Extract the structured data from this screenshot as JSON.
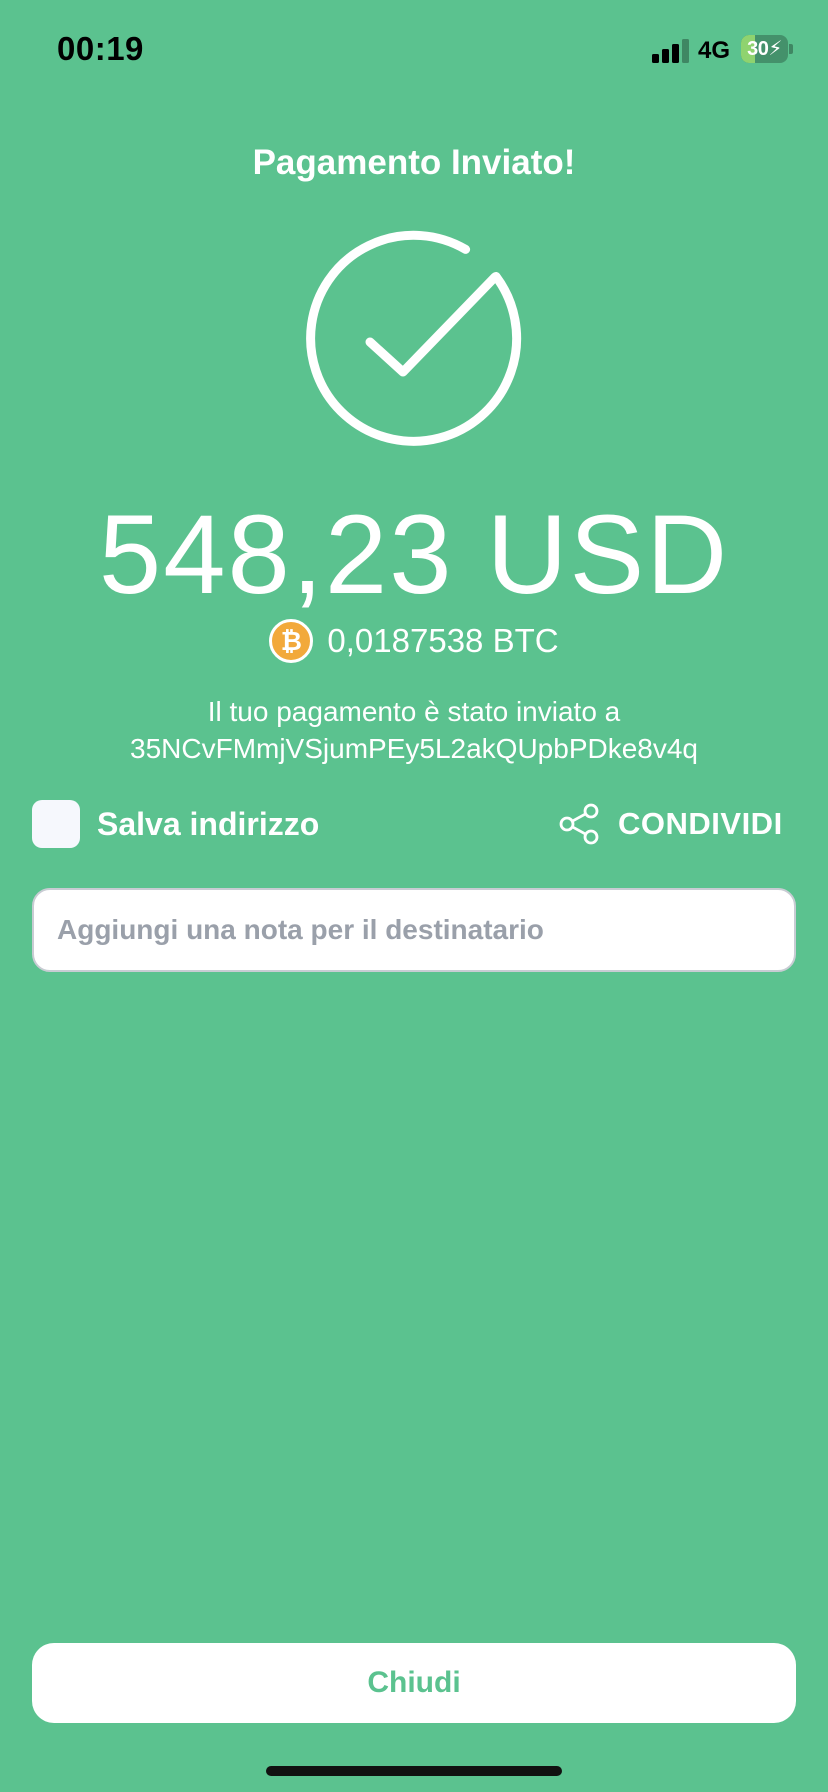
{
  "status_bar": {
    "time": "00:19",
    "network": "4G",
    "battery_level": "30",
    "battery_fraction": 0.3,
    "signal_icon": "cellular-signal-icon",
    "battery_icon": "battery-charging-icon"
  },
  "title": "Pagamento Inviato!",
  "success_icon": "checkmark-circle-icon",
  "amount": {
    "usd": "548,23 USD",
    "btc": "0,0187538 BTC",
    "btc_icon": "bitcoin-icon",
    "btc_symbol": "₿"
  },
  "message": {
    "line1": "Il tuo pagamento è stato inviato a",
    "address": "35NCvFMmjVSjumPEy5L2akQUpbPDke8v4q"
  },
  "save_address": {
    "label": "Salva indirizzo",
    "checked": false
  },
  "share": {
    "label": "CONDIVIDI",
    "icon": "share-icon"
  },
  "note": {
    "placeholder": "Aggiungi una nota per il destinatario",
    "value": ""
  },
  "close_button": {
    "label": "Chiudi"
  },
  "colors": {
    "background": "#5bc28f",
    "accent": "#5bc28f",
    "bitcoin": "#f2a93b",
    "text": "#ffffff"
  }
}
